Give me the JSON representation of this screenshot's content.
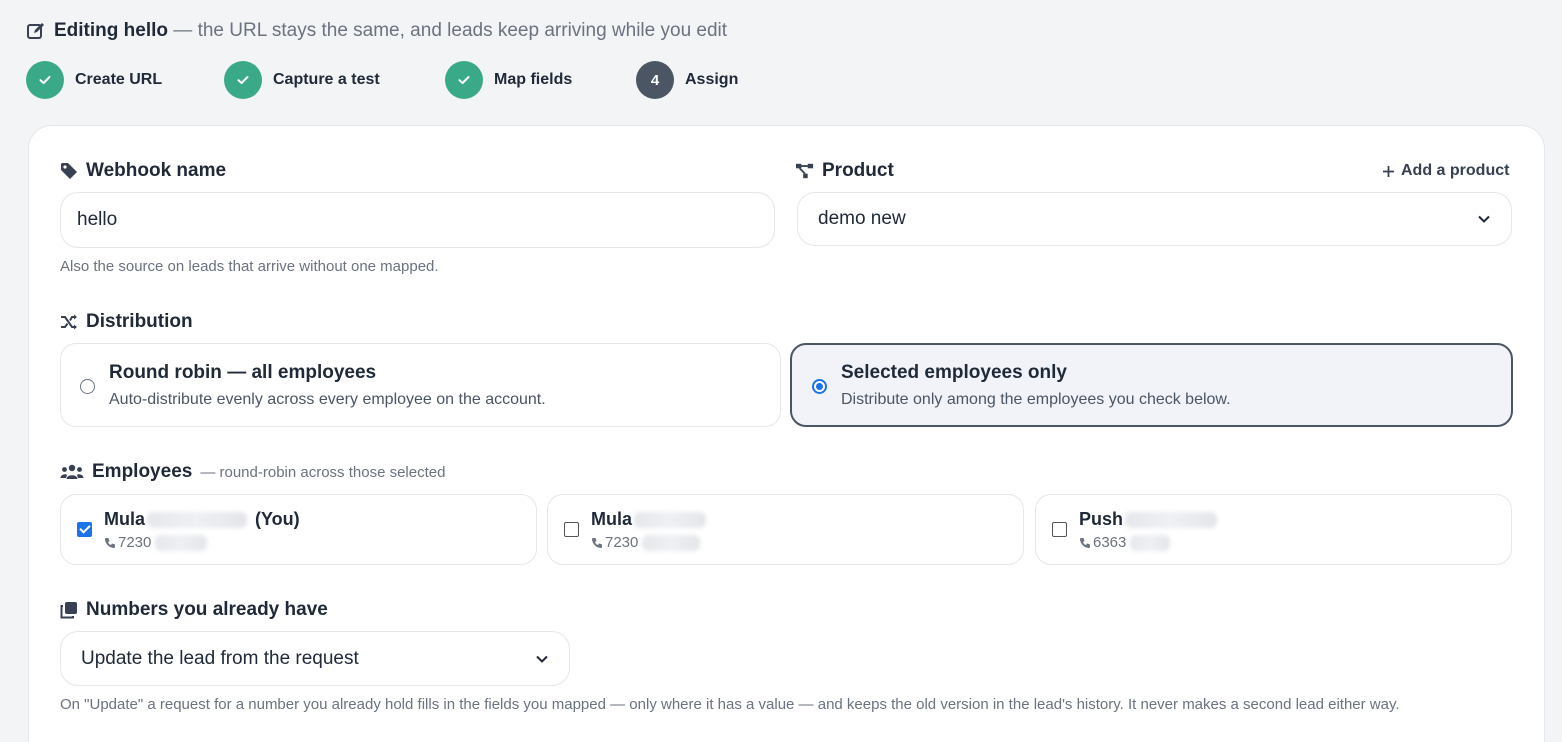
{
  "header": {
    "editing_prefix": "Editing",
    "webhook_title": "hello",
    "subtitle": "— the URL stays the same, and leads keep arriving while you edit"
  },
  "stepper": {
    "steps": [
      {
        "label": "Create URL",
        "status": "done"
      },
      {
        "label": "Capture a test",
        "status": "done"
      },
      {
        "label": "Map fields",
        "status": "done"
      },
      {
        "label": "Assign",
        "status": "current",
        "number": "4"
      }
    ]
  },
  "webhook_name": {
    "label": "Webhook name",
    "value": "hello",
    "hint": "Also the source on leads that arrive without one mapped."
  },
  "product": {
    "label": "Product",
    "add_link": "Add a product",
    "selected": "demo new"
  },
  "distribution": {
    "label": "Distribution",
    "options": [
      {
        "title": "Round robin — all employees",
        "description": "Auto-distribute evenly across every employee on the account.",
        "selected": false
      },
      {
        "title": "Selected employees only",
        "description": "Distribute only among the employees you check below.",
        "selected": true
      }
    ]
  },
  "employees": {
    "label": "Employees",
    "sublabel": "— round-robin across those selected",
    "list": [
      {
        "name": "Mula",
        "you_tag": "(You)",
        "phone": "7230",
        "checked": true
      },
      {
        "name": "Mula",
        "you_tag": "",
        "phone": "7230",
        "checked": false
      },
      {
        "name": "Push",
        "you_tag": "",
        "phone": "6363",
        "checked": false
      }
    ]
  },
  "existing_numbers": {
    "label": "Numbers you already have",
    "selected": "Update the lead from the request",
    "hint": "On \"Update\" a request for a number you already hold fills in the fields you mapped — only where it has a value — and keeps the old version in the lead's history. It never makes a second lead either way."
  },
  "colors": {
    "done_step": "#3aa988",
    "current_step": "#4b5563",
    "accent_blue": "#1a73e8",
    "selected_card_bg": "#f1f3f9"
  }
}
